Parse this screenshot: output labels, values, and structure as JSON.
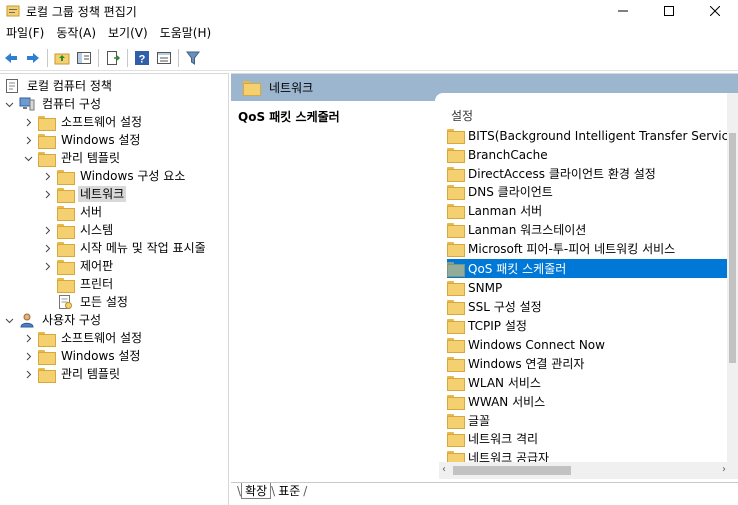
{
  "window": {
    "title": "로컬 그룹 정책 편집기",
    "minimize_icon": "minimize-icon",
    "maximize_icon": "maximize-icon",
    "close_icon": "close-icon"
  },
  "menu": [
    "파일(F)",
    "동작(A)",
    "보기(V)",
    "도움말(H)"
  ],
  "toolbar": [
    "back-arrow-icon",
    "forward-arrow-icon",
    "up-folder-icon",
    "show-hide-tree-icon",
    "export-list-icon",
    "help-icon",
    "properties-view-icon",
    "filter-icon"
  ],
  "tree": {
    "root": "로컬 컴퓨터 정책",
    "computer_config": "컴퓨터 구성",
    "software_settings": "소프트웨어 설정",
    "windows_settings": "Windows 설정",
    "admin_templates": "관리 템플릿",
    "windows_components": "Windows 구성 요소",
    "network": "네트워크",
    "server": "서버",
    "system": "시스템",
    "start_menu_taskbar": "시작 메뉴 및 작업 표시줄",
    "control_panel": "제어판",
    "printers": "프린터",
    "all_settings": "모든 설정",
    "user_config": "사용자 구성",
    "user_software_settings": "소프트웨어 설정",
    "user_windows_settings": "Windows 설정",
    "user_admin_templates": "관리 템플릿"
  },
  "right_pane": {
    "header": "네트워크",
    "description_title": "QoS 패킷 스케줄러",
    "list_header": "설정",
    "items": [
      "BITS(Background Intelligent Transfer Service)",
      "BranchCache",
      "DirectAccess 클라이언트 환경 설정",
      "DNS 클라이언트",
      "Lanman 서버",
      "Lanman 워크스테이션",
      "Microsoft 피어-투-피어 네트워킹 서비스",
      "QoS 패킷 스케줄러",
      "SNMP",
      "SSL 구성 설정",
      "TCPIP 설정",
      "Windows Connect Now",
      "Windows 연결 관리자",
      "WLAN 서비스",
      "WWAN 서비스",
      "글꼴",
      "네트워크 격리",
      "네트워크 공급자"
    ],
    "selected_item": "QoS 패킷 스케줄러"
  },
  "tabs": {
    "extended": "확장",
    "standard": "표준"
  },
  "colors": {
    "selection": "#0078d7",
    "header_bar": "#9db6cf",
    "folder": "#f5d070"
  }
}
